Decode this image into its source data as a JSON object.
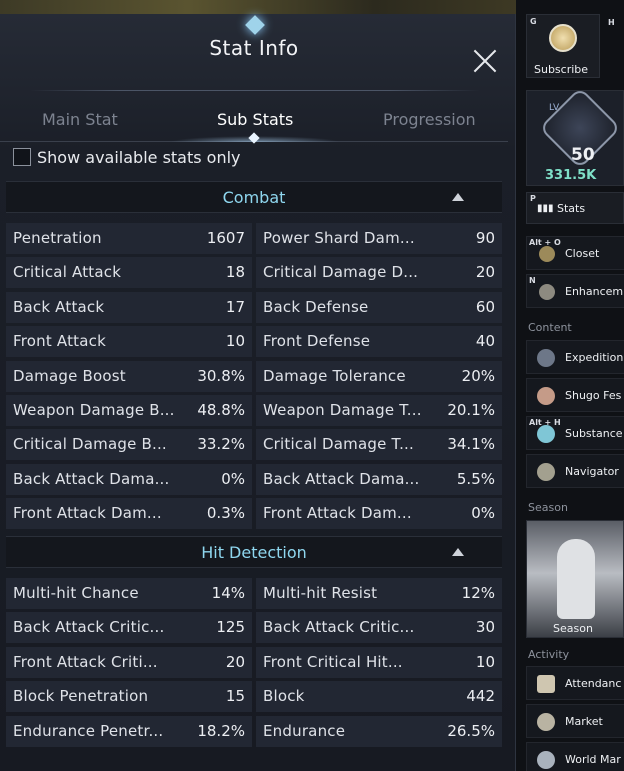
{
  "panel": {
    "title": "Stat Info",
    "tabs": [
      {
        "label": "Main Stat",
        "active": false
      },
      {
        "label": "Sub Stats",
        "active": true
      },
      {
        "label": "Progression",
        "active": false
      }
    ],
    "filter_label": "Show available stats only",
    "filter_checked": false
  },
  "sections": [
    {
      "title": "Combat",
      "rows": [
        [
          {
            "name": "Penetration",
            "value": "1607"
          },
          {
            "name": "Power Shard Dam...",
            "value": "90"
          }
        ],
        [
          {
            "name": "Critical Attack",
            "value": "18"
          },
          {
            "name": "Critical Damage D...",
            "value": "20"
          }
        ],
        [
          {
            "name": "Back Attack",
            "value": "17"
          },
          {
            "name": "Back Defense",
            "value": "60"
          }
        ],
        [
          {
            "name": "Front Attack",
            "value": "10"
          },
          {
            "name": "Front Defense",
            "value": "40"
          }
        ],
        [
          {
            "name": "Damage Boost",
            "value": "30.8%"
          },
          {
            "name": "Damage Tolerance",
            "value": "20%"
          }
        ],
        [
          {
            "name": "Weapon Damage B...",
            "value": "48.8%"
          },
          {
            "name": "Weapon Damage T...",
            "value": "20.1%"
          }
        ],
        [
          {
            "name": "Critical Damage B...",
            "value": "33.2%"
          },
          {
            "name": "Critical Damage T...",
            "value": "34.1%"
          }
        ],
        [
          {
            "name": "Back Attack Dama...",
            "value": "0%"
          },
          {
            "name": "Back Attack Dama...",
            "value": "5.5%"
          }
        ],
        [
          {
            "name": "Front Attack Dam...",
            "value": "0.3%"
          },
          {
            "name": "Front Attack Dam...",
            "value": "0%"
          }
        ]
      ]
    },
    {
      "title": "Hit Detection",
      "rows": [
        [
          {
            "name": "Multi-hit Chance",
            "value": "14%"
          },
          {
            "name": "Multi-hit Resist",
            "value": "12%"
          }
        ],
        [
          {
            "name": "Back Attack Critic...",
            "value": "125"
          },
          {
            "name": "Back Attack Critic...",
            "value": "30"
          }
        ],
        [
          {
            "name": "Front Attack Criti...",
            "value": "20"
          },
          {
            "name": "Front Critical Hit...",
            "value": "10"
          }
        ],
        [
          {
            "name": "Block Penetration",
            "value": "15"
          },
          {
            "name": "Block",
            "value": "442"
          }
        ],
        [
          {
            "name": "Endurance Penetr...",
            "value": "18.2%"
          },
          {
            "name": "Endurance",
            "value": "26.5%"
          }
        ]
      ]
    }
  ],
  "sidebar": {
    "subscribe": {
      "key": "G",
      "key2": "H",
      "label": "Subscribe"
    },
    "level": {
      "badge": "LV",
      "value": "50",
      "power": "331.5K"
    },
    "stats": {
      "key": "P",
      "label": "Stats"
    },
    "items": [
      {
        "key": "Alt + O",
        "label": "Closet",
        "icon": "closet-icon"
      },
      {
        "key": "N",
        "label": "Enhancem",
        "icon": "anvil-icon"
      }
    ],
    "content_label": "Content",
    "content_items": [
      {
        "label": "Expedition",
        "icon": "gate-icon"
      },
      {
        "label": "Shugo Fes",
        "icon": "shugo-icon"
      },
      {
        "label": "Substance",
        "key": "Alt + H",
        "icon": "orb-icon"
      },
      {
        "label": "Navigator",
        "icon": "compass-icon"
      }
    ],
    "season_label": "Season",
    "season_card_label": "Season",
    "activity_label": "Activity",
    "activity_items": [
      {
        "label": "Attendanc",
        "icon": "attendance-icon"
      },
      {
        "label": "Market",
        "icon": "scales-icon"
      },
      {
        "label": "World Mar",
        "icon": "globe-market-icon"
      }
    ],
    "colors": {
      "accent": "#8fd7ef",
      "power": "#7fe0c8"
    }
  }
}
